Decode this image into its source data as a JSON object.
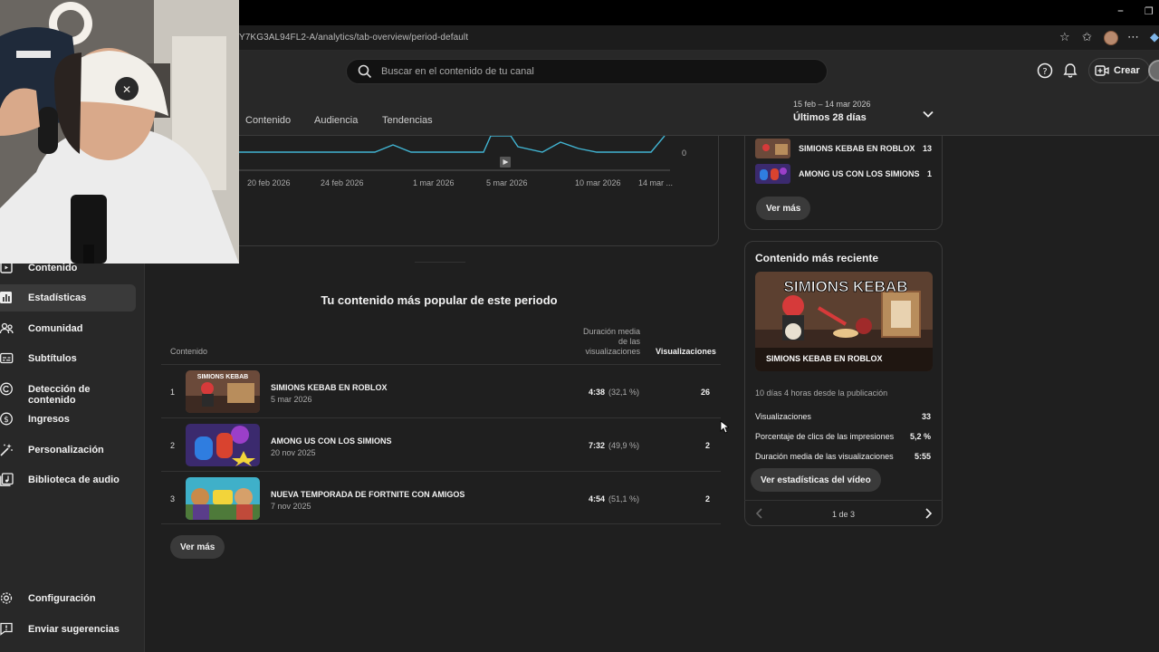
{
  "browser": {
    "url": "Y7KG3AL94FL2-A/analytics/tab-overview/period-default"
  },
  "header": {
    "search_placeholder": "Buscar en el contenido de tu canal",
    "create_label": "Crear"
  },
  "tabs": [
    {
      "label": "Contenido"
    },
    {
      "label": "Audiencia"
    },
    {
      "label": "Tendencias"
    }
  ],
  "period": {
    "range": "15 feb – 14 mar 2026",
    "label": "Últimos 28 días"
  },
  "chart_data": {
    "type": "line",
    "x": [
      "20 feb 2026",
      "24 feb 2026",
      "1 mar 2026",
      "5 mar 2026",
      "10 mar 2026",
      "14 mar ..."
    ],
    "y_tick_labels": [
      "0"
    ],
    "color": "#41b4d2"
  },
  "popular": {
    "title": "Tu contenido más popular de este periodo",
    "col_content": "Contenido",
    "col_duration": "Duración media de las visualizaciones",
    "col_views": "Visualizaciones",
    "rows": [
      {
        "rank": "1",
        "title": "SIMIONS KEBAB EN ROBLOX",
        "date": "5 mar 2026",
        "duration": "4:38",
        "pct": "(32,1 %)",
        "views": "26"
      },
      {
        "rank": "2",
        "title": "AMONG US CON LOS SIMIONS",
        "date": "20 nov 2025",
        "duration": "7:32",
        "pct": "(49,9 %)",
        "views": "2"
      },
      {
        "rank": "3",
        "title": "NUEVA TEMPORADA DE FORTNITE CON AMIGOS",
        "date": "7 nov 2025",
        "duration": "4:54",
        "pct": "(51,1 %)",
        "views": "2"
      }
    ],
    "more_label": "Ver más"
  },
  "realtime": {
    "rows": [
      {
        "title": "SIMIONS KEBAB EN ROBLOX",
        "value": "13"
      },
      {
        "title": "AMONG US CON LOS SIMIONS",
        "value": "1"
      }
    ],
    "more_label": "Ver más"
  },
  "recent": {
    "title": "Contenido más reciente",
    "thumb_headline": "SIMIONS KEBAB",
    "thumb_caption": "SIMIONS KEBAB EN ROBLOX",
    "since": "10 días 4 horas desde la publicación",
    "stats": [
      {
        "label": "Visualizaciones",
        "value": "33"
      },
      {
        "label": "Porcentaje de clics de las impresiones",
        "value": "5,2 %"
      },
      {
        "label": "Duración media de las visualizaciones",
        "value": "5:55"
      }
    ],
    "stats_button": "Ver estadísticas del vídeo",
    "pager": "1 de 3"
  },
  "sidebar": {
    "items": [
      {
        "label": "Contenido"
      },
      {
        "label": "Estadísticas"
      },
      {
        "label": "Comunidad"
      },
      {
        "label": "Subtítulos"
      },
      {
        "label": "Detección de contenido"
      },
      {
        "label": "Ingresos"
      },
      {
        "label": "Personalización"
      },
      {
        "label": "Biblioteca de audio"
      }
    ],
    "settings_label": "Configuración",
    "feedback_label": "Enviar sugerencias"
  },
  "colors": {
    "accent": "#41b4d2",
    "background": "#1f1f1f",
    "panel": "#282828"
  }
}
